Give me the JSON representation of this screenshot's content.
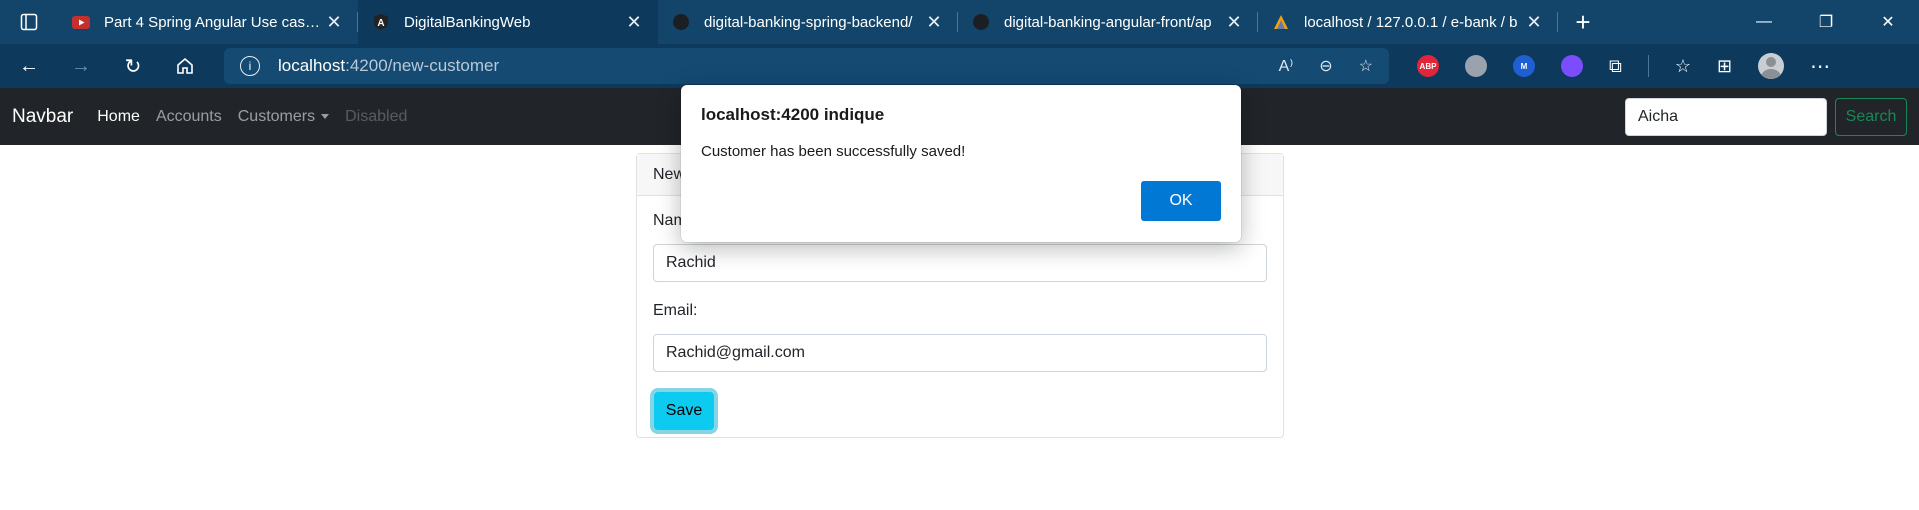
{
  "browser": {
    "tabs": [
      {
        "title": "Part 4 Spring Angular Use case D",
        "icon": "youtube-icon",
        "active": false
      },
      {
        "title": "DigitalBankingWeb",
        "icon": "angular-icon",
        "active": true
      },
      {
        "title": "digital-banking-spring-backend/",
        "icon": "github-icon",
        "active": false
      },
      {
        "title": "digital-banking-angular-front/ap",
        "icon": "github-icon",
        "active": false
      },
      {
        "title": "localhost / 127.0.0.1 / e-bank / b",
        "icon": "phpmyadmin-icon",
        "active": false
      }
    ],
    "address": {
      "host": "localhost",
      "path": ":4200/new-customer"
    },
    "extensions": [
      {
        "name": "adblock-plus-icon",
        "label": "ABP",
        "color": "#e2253b"
      },
      {
        "name": "extension-bug-icon",
        "label": "",
        "color": "#9aa3ad"
      },
      {
        "name": "malwarebytes-icon",
        "label": "M",
        "color": "#1f5fd1"
      },
      {
        "name": "chat-extension-icon",
        "label": "",
        "color": "#7c4dff"
      }
    ]
  },
  "navbar": {
    "brand": "Navbar",
    "links": [
      "Home",
      "Accounts",
      "Customers",
      "Disabled"
    ],
    "search_value": "Aicha",
    "search_button": "Search"
  },
  "card": {
    "header": "New",
    "name_label": "Nam",
    "name_value": "Rachid",
    "email_label": "Email:",
    "email_value": "Rachid@gmail.com",
    "save_label": "Save"
  },
  "dialog": {
    "title": "localhost:4200 indique",
    "message": "Customer has been successfully saved!",
    "ok_label": "OK"
  },
  "colors": {
    "tabbar": "#13456b",
    "navbar": "#212529",
    "save": "#0dcaf0",
    "ok": "#0078d4",
    "search": "#198754"
  }
}
